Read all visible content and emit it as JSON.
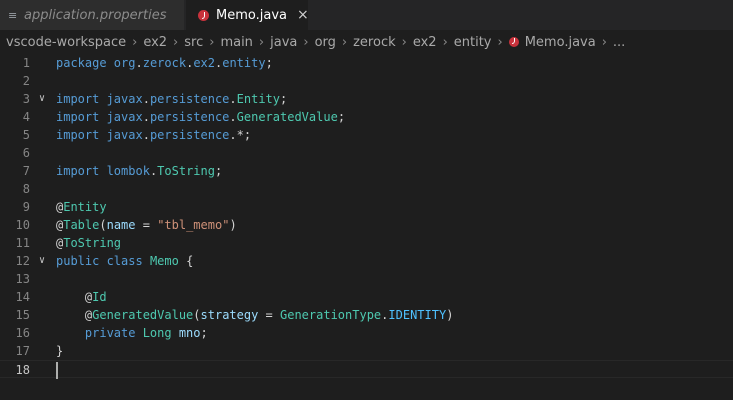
{
  "tabs": [
    {
      "label": "application.properties",
      "icon": "properties-file-icon",
      "active": false
    },
    {
      "label": "Memo.java",
      "icon": "java-file-icon",
      "active": true,
      "close": "×"
    }
  ],
  "breadcrumb": {
    "items": [
      "vscode-workspace",
      "ex2",
      "src",
      "main",
      "java",
      "org",
      "zerock",
      "ex2",
      "entity"
    ],
    "file": "Memo.java",
    "more": "..."
  },
  "editor": {
    "current_line": 18,
    "line_numbers": [
      "1",
      "2",
      "3",
      "4",
      "5",
      "6",
      "7",
      "8",
      "9",
      "10",
      "11",
      "12",
      "13",
      "14",
      "15",
      "16",
      "17",
      "18"
    ],
    "lines": {
      "l1": {
        "a": "package ",
        "b": "org",
        "c": ".",
        "d": "zerock",
        "e": ".",
        "f": "ex2",
        "g": ".",
        "h": "entity",
        "i": ";"
      },
      "l3": {
        "a": "import ",
        "b": "javax",
        "c": ".",
        "d": "persistence",
        "e": ".",
        "f": "Entity",
        "g": ";"
      },
      "l4": {
        "a": "import ",
        "b": "javax",
        "c": ".",
        "d": "persistence",
        "e": ".",
        "f": "GeneratedValue",
        "g": ";"
      },
      "l5": {
        "a": "import ",
        "b": "javax",
        "c": ".",
        "d": "persistence",
        "e": ".*;"
      },
      "l7": {
        "a": "import ",
        "b": "lombok",
        "c": ".",
        "d": "ToString",
        "e": ";"
      },
      "l9": {
        "a": "@",
        "b": "Entity"
      },
      "l10": {
        "a": "@",
        "b": "Table",
        "c": "(",
        "d": "name",
        "e": " = ",
        "f": "\"tbl_memo\"",
        "g": ")"
      },
      "l11": {
        "a": "@",
        "b": "ToString"
      },
      "l12": {
        "a": "public ",
        "b": "class ",
        "c": "Memo",
        "d": " {"
      },
      "l14": {
        "a": "    @",
        "b": "Id"
      },
      "l15": {
        "a": "    @",
        "b": "GeneratedValue",
        "c": "(",
        "d": "strategy",
        "e": " = ",
        "f": "GenerationType",
        "g": ".",
        "h": "IDENTITY",
        "i": ")"
      },
      "l16": {
        "a": "    ",
        "b": "private ",
        "c": "Long ",
        "d": "mno",
        "e": ";"
      },
      "l17": {
        "a": "}"
      }
    }
  }
}
